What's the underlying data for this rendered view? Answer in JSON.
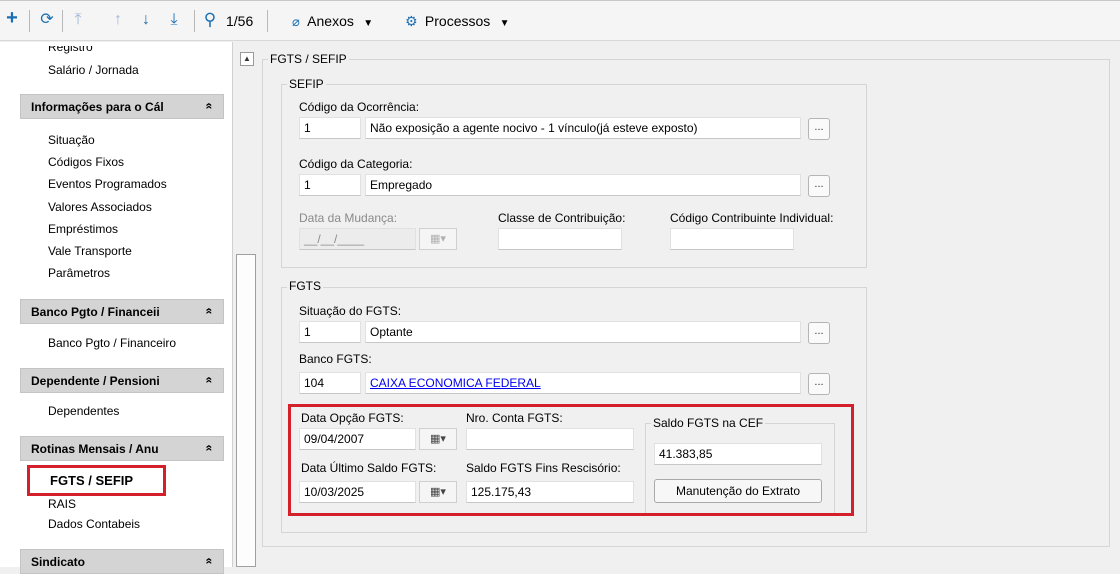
{
  "toolbar": {
    "add_icon": "+",
    "refresh_icon": "⟳",
    "first_icon": "⤒",
    "up_icon": "↑",
    "down_icon": "↓",
    "last_icon": "⤓",
    "search_icon": "⚲",
    "record_counter": "1/56",
    "attachments_label": "Anexos",
    "processes_label": "Processos"
  },
  "sidebar": {
    "top_items": [
      "Registro",
      "Salário / Jornada"
    ],
    "sections": [
      {
        "title": "Informações para o Cál",
        "items": [
          "Situação",
          "Códigos Fixos",
          "Eventos Programados",
          "Valores Associados",
          "Empréstimos",
          "Vale Transporte",
          "Parâmetros"
        ]
      },
      {
        "title": "Banco Pgto / Financeii",
        "items": [
          "Banco Pgto / Financeiro"
        ]
      },
      {
        "title": "Dependente / Pensioni",
        "items": [
          "Dependentes"
        ]
      },
      {
        "title": "Rotinas Mensais / Anu",
        "items": [
          "FGTS / SEFIP",
          "RAIS",
          "Dados Contabeis"
        ]
      },
      {
        "title": "Sindicato",
        "items": []
      }
    ],
    "chevron": "«"
  },
  "main": {
    "title": "FGTS / SEFIP",
    "sefip": {
      "legend": "SEFIP",
      "occurrence_label": "Código da Ocorrência:",
      "occurrence_code": "1",
      "occurrence_desc": "Não exposição a agente nocivo - 1 vínculo(já esteve exposto)",
      "category_label": "Código da Categoria:",
      "category_code": "1",
      "category_desc": "Empregado",
      "change_date_label": "Data da Mudança:",
      "change_date_value": "__/__/____",
      "contrib_class_label": "Classe de Contribuição:",
      "contrib_class_value": "",
      "individual_code_label": "Código Contribuinte Individual:",
      "individual_code_value": ""
    },
    "fgts": {
      "legend": "FGTS",
      "status_label": "Situação do FGTS:",
      "status_code": "1",
      "status_desc": "Optante",
      "bank_label": "Banco FGTS:",
      "bank_code": "104",
      "bank_name": "CAIXA ECONOMICA FEDERAL",
      "option_date_label": "Data Opção FGTS:",
      "option_date_value": "09/04/2007",
      "account_label": "Nro. Conta FGTS:",
      "account_value": "",
      "last_balance_date_label": "Data Último Saldo FGTS:",
      "last_balance_date_value": "10/03/2025",
      "termination_balance_label": "Saldo FGTS Fins Rescisório:",
      "termination_balance_value": "125.175,43",
      "cef_balance_legend": "Saldo FGTS na CEF",
      "cef_balance_value": "41.383,85",
      "maintenance_button": "Manutenção do Extrato"
    },
    "ellipsis": "...",
    "calendar_icon": "▦▾",
    "collapse_icon": "▲"
  },
  "colors": {
    "highlight": "#d4202a",
    "accent": "#1a6fb3",
    "link": "#0000ee"
  }
}
